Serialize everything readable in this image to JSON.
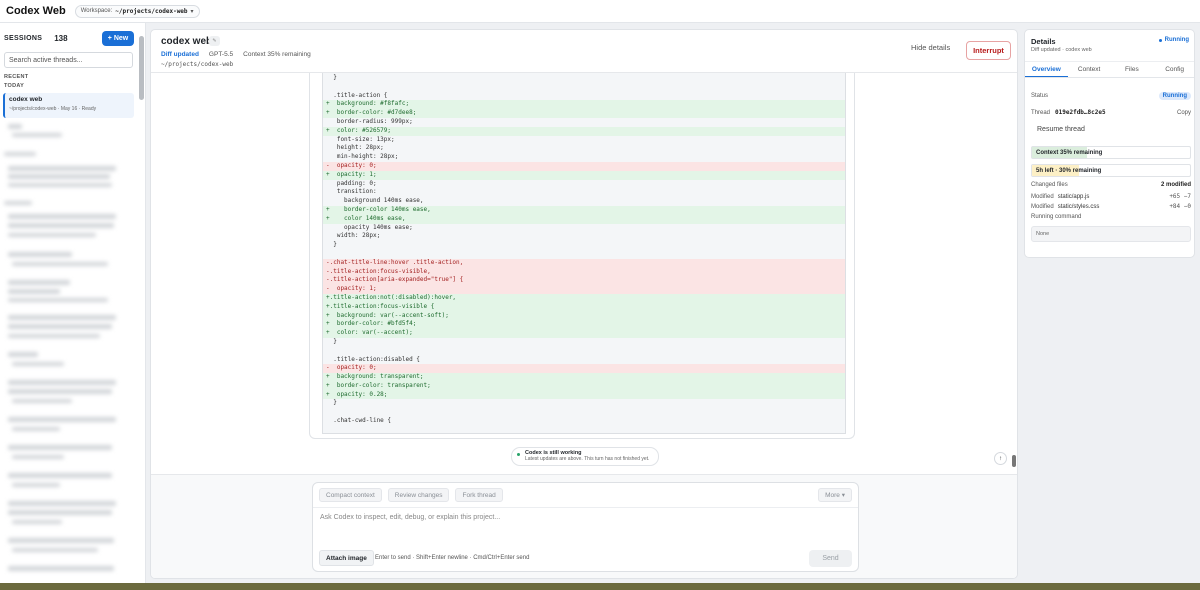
{
  "app": {
    "brand": "Codex Web",
    "workspace_label": "Workspace:",
    "workspace_path": "~/projects/codex-web",
    "workspace_chevron": "▾"
  },
  "sidebar": {
    "title": "SESSIONS",
    "count": "138",
    "new_label": "+ New",
    "search_placeholder": "Search active threads...",
    "section_recent": "RECENT",
    "section_today": "TODAY",
    "active_thread": {
      "title": "codex web",
      "meta": "~/projects/codex-web · May 16 · Ready"
    }
  },
  "main": {
    "title": "codex web",
    "title_tag": "✎",
    "diff_status": "Diff updated",
    "model": "GPT-5.5",
    "context": "Context 35% remaining",
    "path": "~/projects/codex-web",
    "hide_details": "Hide details",
    "interrupt": "Interrupt",
    "diff_lines": [
      {
        "t": "",
        "text": "  }"
      },
      {
        "t": "",
        "text": ""
      },
      {
        "t": "",
        "text": "  .title-action {"
      },
      {
        "t": "add",
        "text": "+  background: #f8fafc;"
      },
      {
        "t": "add",
        "text": "+  border-color: #d7dee8;"
      },
      {
        "t": "",
        "text": "   border-radius: 999px;"
      },
      {
        "t": "add",
        "text": "+  color: #526579;"
      },
      {
        "t": "",
        "text": "   font-size: 13px;"
      },
      {
        "t": "",
        "text": "   height: 28px;"
      },
      {
        "t": "",
        "text": "   min-height: 28px;"
      },
      {
        "t": "del",
        "text": "-  opacity: 0;"
      },
      {
        "t": "add",
        "text": "+  opacity: 1;"
      },
      {
        "t": "",
        "text": "   padding: 0;"
      },
      {
        "t": "",
        "text": "   transition:"
      },
      {
        "t": "",
        "text": "     background 140ms ease,"
      },
      {
        "t": "add",
        "text": "+    border-color 140ms ease,"
      },
      {
        "t": "add",
        "text": "+    color 140ms ease,"
      },
      {
        "t": "",
        "text": "     opacity 140ms ease;"
      },
      {
        "t": "",
        "text": "   width: 28px;"
      },
      {
        "t": "",
        "text": "  }"
      },
      {
        "t": "",
        "text": ""
      },
      {
        "t": "del",
        "text": "-.chat-title-line:hover .title-action,"
      },
      {
        "t": "del",
        "text": "-.title-action:focus-visible,"
      },
      {
        "t": "del",
        "text": "-.title-action[aria-expanded=\"true\"] {"
      },
      {
        "t": "del",
        "text": "-  opacity: 1;"
      },
      {
        "t": "add",
        "text": "+.title-action:not(:disabled):hover,"
      },
      {
        "t": "add",
        "text": "+.title-action:focus-visible {"
      },
      {
        "t": "add",
        "text": "+  background: var(--accent-soft);"
      },
      {
        "t": "add",
        "text": "+  border-color: #bfd5f4;"
      },
      {
        "t": "add",
        "text": "+  color: var(--accent);"
      },
      {
        "t": "",
        "text": "  }"
      },
      {
        "t": "",
        "text": ""
      },
      {
        "t": "",
        "text": "  .title-action:disabled {"
      },
      {
        "t": "del",
        "text": "-  opacity: 0;"
      },
      {
        "t": "add",
        "text": "+  background: transparent;"
      },
      {
        "t": "add",
        "text": "+  border-color: transparent;"
      },
      {
        "t": "add",
        "text": "+  opacity: 0.28;"
      },
      {
        "t": "",
        "text": "  }"
      },
      {
        "t": "",
        "text": ""
      },
      {
        "t": "",
        "text": "  .chat-cwd-line {"
      }
    ],
    "working_title": "Codex is still working",
    "working_sub": "Latest updates are above. This turn has not finished yet.",
    "scroll_up": "↑"
  },
  "composer": {
    "chips": [
      "Compact context",
      "Review changes",
      "Fork thread"
    ],
    "more": "More ▾",
    "placeholder": "Ask Codex to inspect, edit, debug, or explain this project...",
    "attach": "Attach image",
    "hint": "Enter to send · Shift+Enter newline · Cmd/Ctrl+Enter send",
    "send": "Send"
  },
  "details": {
    "title": "Details",
    "sub": "Diff updated · codex web",
    "running": "Running",
    "tabs": [
      "Overview",
      "Context",
      "Files",
      "Config"
    ],
    "status_label": "Status",
    "status_value": "Running",
    "thread_label": "Thread",
    "thread_id": "019e2fdb…8c2e5",
    "copy": "Copy",
    "resume": "Resume thread",
    "context_bar": "Context 35% remaining",
    "context_fraction": 0.35,
    "limit_bar": "5h left · 30% remaining",
    "limit_fraction": 0.3,
    "changed_label": "Changed files",
    "changed_count": "2 modified",
    "files": [
      {
        "state": "Modified",
        "path": "static/app.js",
        "diff": "+65 −7"
      },
      {
        "state": "Modified",
        "path": "static/styles.css",
        "diff": "+84 −0"
      }
    ],
    "running_cmd_label": "Running command",
    "running_cmd_value": "None"
  },
  "colors": {
    "accent": "#1a6fd6",
    "danger": "#b71c1c",
    "add_bg": "#e3f5e7",
    "del_bg": "#fbe4e4"
  }
}
